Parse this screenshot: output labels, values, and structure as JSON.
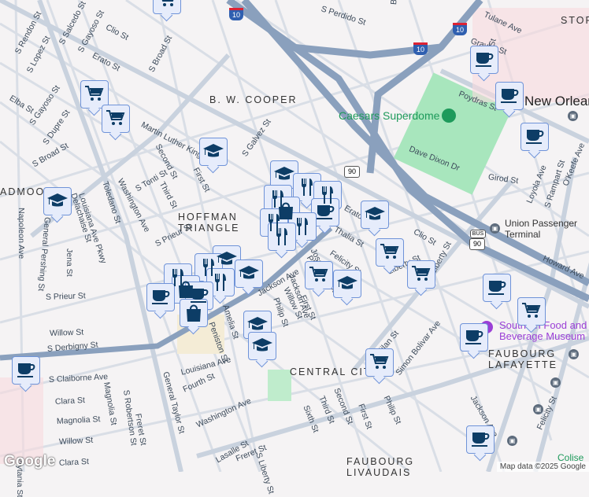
{
  "neighborhoods": [
    "B. W. COOPER",
    "HOFFMAN",
    "TRIANGLE",
    "CENTRAL CITY",
    "FAUBOURG",
    "LAFAYETTE",
    "FAUBOURG",
    "LIVAUDAIS",
    "STORY",
    "ADMOOR"
  ],
  "city": "New Orleans",
  "pois": {
    "superdome": "Caesars Superdome",
    "museum_1": "Southern Food and",
    "museum_2": "Beverage Museum",
    "terminal_1": "Union Passenger",
    "terminal_2": "Terminal",
    "coliseum": "Colise"
  },
  "streets": [
    "S Rendon St",
    "S Lopez St",
    "S Salcedo St",
    "S Gayoso St",
    "Clio St",
    "Erato St",
    "Elba St",
    "S Gayoso St",
    "S Dupre St",
    "S Broad St",
    "S Broad St",
    "Martin Luther King Blvd",
    "S Galvez St",
    "Second St",
    "First St",
    "S Tonti St",
    "Third St",
    "Washington Ave",
    "Toledano St",
    "Louisiana Ave Pkwy",
    "Delachaise St",
    "General Pershing St",
    "Napoleon Ave",
    "S Perdido St",
    "Bolivar",
    "Tulane Ave",
    "Gravier St",
    "Lasalle St",
    "Poydras St",
    "Dave Dixon Dr",
    "Girod St",
    "Loyola Ave",
    "S Rampart St",
    "O'Keefe Ave",
    "Erato St",
    "Thalia St",
    "Clio St",
    "Howard Ave",
    "Felicity St",
    "Jackson Ave",
    "S Liberty St",
    "Simon Bolivar Ave",
    "Philip St",
    "S Prieur St",
    "S Prieur St",
    "Willow St",
    "S Derbigny St",
    "S Claiborne Ave",
    "Clara St",
    "Magnolia St",
    "Willow St",
    "Clara St",
    "Magnolia St",
    "S Robertson St",
    "Freret St",
    "General Taylor St",
    "Amelia St",
    "Peniston St",
    "Louisiana Ave",
    "Fourth St",
    "Washington Ave",
    "Freret St",
    "Lasalle St",
    "S Liberty St",
    "Sixth St",
    "Third St",
    "Second St",
    "First St",
    "Philip St",
    "Jackson Ave",
    "Felicity St",
    "Prytania St",
    "Jena St",
    "Milan St",
    "Liberty St",
    "Jackson Ave",
    "Willow St",
    "First St",
    "Philip St",
    "Josephine St"
  ],
  "highways": {
    "i10_a": "10",
    "i10_b": "10",
    "i10_c": "10",
    "us90_a": "90",
    "us90_b": "90",
    "bus": "BUS"
  },
  "attribution": "Map data ©2025 Google",
  "logo": "Google",
  "marker_colors": {
    "fill": "#e6ecfb",
    "border": "#6f93d8",
    "icon": "#0d3d66"
  }
}
